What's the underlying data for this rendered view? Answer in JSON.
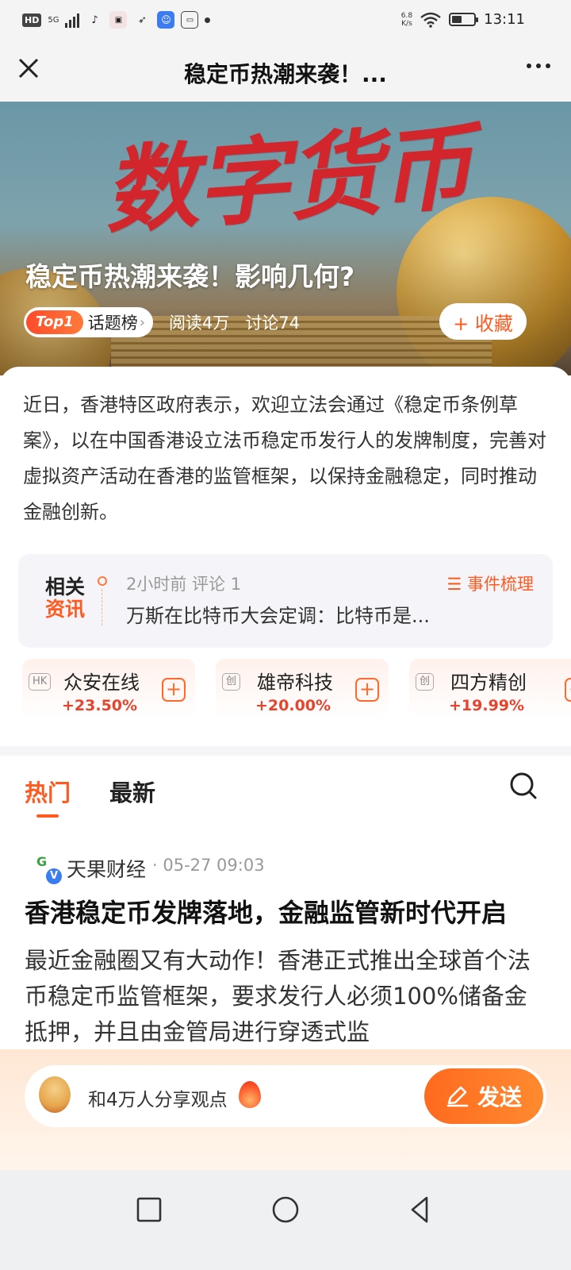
{
  "status_bar": {
    "network": "HD",
    "signal": "5G",
    "speed_value": "6.8",
    "speed_unit": "K/s",
    "battery_level": 0.45,
    "time": "13:11"
  },
  "title_bar": {
    "title": "稳定币热潮来袭！..."
  },
  "hero": {
    "image_text": "数字货币",
    "title": "稳定币热潮来袭！影响几何?",
    "rank_badge": "Top1",
    "rank_label": "话题榜",
    "reads": "阅读4万",
    "discussions": "讨论74",
    "collect_label": "+ 收藏"
  },
  "intro": "近日，香港特区政府表示，欢迎立法会通过《稳定币条例草案》，以在中国香港设立法币稳定币发行人的发牌制度，完善对虚拟资产活动在香港的监管框架，以保持金融稳定，同时推动金融创新。",
  "related_news": {
    "tag_line1": "相关",
    "tag_line2": "资讯",
    "meta": "2小时前 评论 1",
    "headline": "万斯在比特币大会定调：比特币是...",
    "event_label": "☰ 事件梳理"
  },
  "stocks": [
    {
      "market": "HK",
      "name": "众安在线",
      "change": "+23.50%"
    },
    {
      "market": "创",
      "name": "雄帝科技",
      "change": "+20.00%"
    },
    {
      "market": "创",
      "name": "四方精创",
      "change": "+19.99%"
    }
  ],
  "tabs": {
    "hot": "热门",
    "latest": "最新"
  },
  "post": {
    "author": "天果财经",
    "time": "· 05-27 09:03",
    "title": "香港稳定币发牌落地，金融监管新时代开启",
    "body": "最近金融圈又有大动作！香港正式推出全球首个法币稳定币监管框架，要求发行人必须100%储备金抵押，并且由金管局进行穿透式监"
  },
  "comment": {
    "placeholder": "和4万人分享观点",
    "send_label": "发送"
  },
  "icons": {
    "close": "close-icon",
    "more": "more-icon",
    "search": "search-icon",
    "edit": "edit-icon",
    "flame": "flame-icon"
  },
  "colors": {
    "accent": "#ff5a1f",
    "gain": "#e8432d",
    "hero_text": "#d3262c"
  }
}
